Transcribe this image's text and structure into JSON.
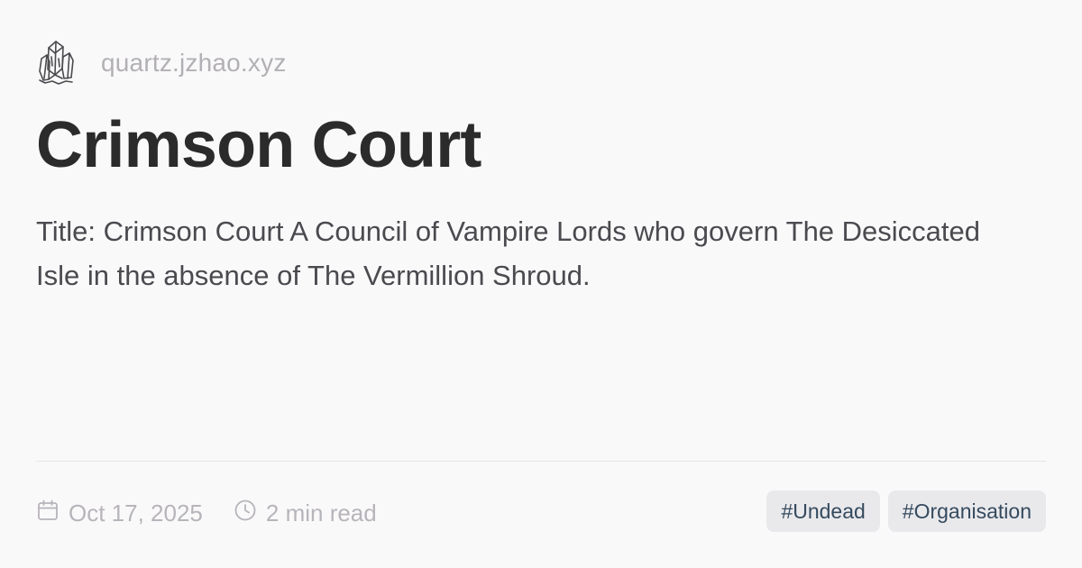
{
  "site": {
    "logo_icon": "crystal-icon",
    "name": "quartz.jzhao.xyz"
  },
  "page": {
    "title": "Crimson Court",
    "description": "Title: Crimson Court A Council of Vampire Lords who govern The Desiccated Isle in the absence of The Vermillion Shroud."
  },
  "meta": {
    "date_icon": "calendar-icon",
    "date": "Oct 17, 2025",
    "reading_icon": "clock-icon",
    "reading_time": "2 min read"
  },
  "tags": [
    {
      "label": "#Undead"
    },
    {
      "label": "#Organisation"
    }
  ]
}
